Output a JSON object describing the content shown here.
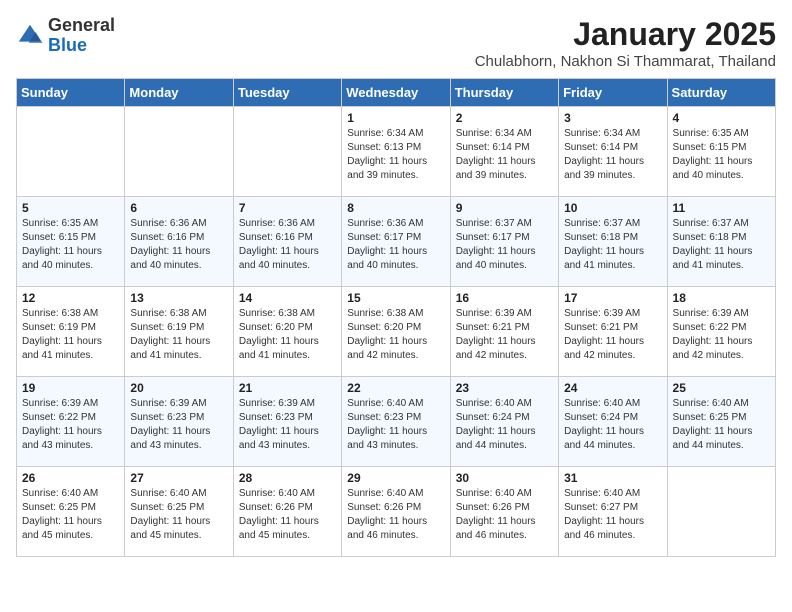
{
  "header": {
    "logo_general": "General",
    "logo_blue": "Blue",
    "title": "January 2025",
    "subtitle": "Chulabhorn, Nakhon Si Thammarat, Thailand"
  },
  "columns": [
    "Sunday",
    "Monday",
    "Tuesday",
    "Wednesday",
    "Thursday",
    "Friday",
    "Saturday"
  ],
  "weeks": [
    [
      {
        "day": "",
        "sunrise": "",
        "sunset": "",
        "daylight": ""
      },
      {
        "day": "",
        "sunrise": "",
        "sunset": "",
        "daylight": ""
      },
      {
        "day": "",
        "sunrise": "",
        "sunset": "",
        "daylight": ""
      },
      {
        "day": "1",
        "sunrise": "6:34 AM",
        "sunset": "6:13 PM",
        "daylight": "11 hours and 39 minutes."
      },
      {
        "day": "2",
        "sunrise": "6:34 AM",
        "sunset": "6:14 PM",
        "daylight": "11 hours and 39 minutes."
      },
      {
        "day": "3",
        "sunrise": "6:34 AM",
        "sunset": "6:14 PM",
        "daylight": "11 hours and 39 minutes."
      },
      {
        "day": "4",
        "sunrise": "6:35 AM",
        "sunset": "6:15 PM",
        "daylight": "11 hours and 40 minutes."
      }
    ],
    [
      {
        "day": "5",
        "sunrise": "6:35 AM",
        "sunset": "6:15 PM",
        "daylight": "11 hours and 40 minutes."
      },
      {
        "day": "6",
        "sunrise": "6:36 AM",
        "sunset": "6:16 PM",
        "daylight": "11 hours and 40 minutes."
      },
      {
        "day": "7",
        "sunrise": "6:36 AM",
        "sunset": "6:16 PM",
        "daylight": "11 hours and 40 minutes."
      },
      {
        "day": "8",
        "sunrise": "6:36 AM",
        "sunset": "6:17 PM",
        "daylight": "11 hours and 40 minutes."
      },
      {
        "day": "9",
        "sunrise": "6:37 AM",
        "sunset": "6:17 PM",
        "daylight": "11 hours and 40 minutes."
      },
      {
        "day": "10",
        "sunrise": "6:37 AM",
        "sunset": "6:18 PM",
        "daylight": "11 hours and 41 minutes."
      },
      {
        "day": "11",
        "sunrise": "6:37 AM",
        "sunset": "6:18 PM",
        "daylight": "11 hours and 41 minutes."
      }
    ],
    [
      {
        "day": "12",
        "sunrise": "6:38 AM",
        "sunset": "6:19 PM",
        "daylight": "11 hours and 41 minutes."
      },
      {
        "day": "13",
        "sunrise": "6:38 AM",
        "sunset": "6:19 PM",
        "daylight": "11 hours and 41 minutes."
      },
      {
        "day": "14",
        "sunrise": "6:38 AM",
        "sunset": "6:20 PM",
        "daylight": "11 hours and 41 minutes."
      },
      {
        "day": "15",
        "sunrise": "6:38 AM",
        "sunset": "6:20 PM",
        "daylight": "11 hours and 42 minutes."
      },
      {
        "day": "16",
        "sunrise": "6:39 AM",
        "sunset": "6:21 PM",
        "daylight": "11 hours and 42 minutes."
      },
      {
        "day": "17",
        "sunrise": "6:39 AM",
        "sunset": "6:21 PM",
        "daylight": "11 hours and 42 minutes."
      },
      {
        "day": "18",
        "sunrise": "6:39 AM",
        "sunset": "6:22 PM",
        "daylight": "11 hours and 42 minutes."
      }
    ],
    [
      {
        "day": "19",
        "sunrise": "6:39 AM",
        "sunset": "6:22 PM",
        "daylight": "11 hours and 43 minutes."
      },
      {
        "day": "20",
        "sunrise": "6:39 AM",
        "sunset": "6:23 PM",
        "daylight": "11 hours and 43 minutes."
      },
      {
        "day": "21",
        "sunrise": "6:39 AM",
        "sunset": "6:23 PM",
        "daylight": "11 hours and 43 minutes."
      },
      {
        "day": "22",
        "sunrise": "6:40 AM",
        "sunset": "6:23 PM",
        "daylight": "11 hours and 43 minutes."
      },
      {
        "day": "23",
        "sunrise": "6:40 AM",
        "sunset": "6:24 PM",
        "daylight": "11 hours and 44 minutes."
      },
      {
        "day": "24",
        "sunrise": "6:40 AM",
        "sunset": "6:24 PM",
        "daylight": "11 hours and 44 minutes."
      },
      {
        "day": "25",
        "sunrise": "6:40 AM",
        "sunset": "6:25 PM",
        "daylight": "11 hours and 44 minutes."
      }
    ],
    [
      {
        "day": "26",
        "sunrise": "6:40 AM",
        "sunset": "6:25 PM",
        "daylight": "11 hours and 45 minutes."
      },
      {
        "day": "27",
        "sunrise": "6:40 AM",
        "sunset": "6:25 PM",
        "daylight": "11 hours and 45 minutes."
      },
      {
        "day": "28",
        "sunrise": "6:40 AM",
        "sunset": "6:26 PM",
        "daylight": "11 hours and 45 minutes."
      },
      {
        "day": "29",
        "sunrise": "6:40 AM",
        "sunset": "6:26 PM",
        "daylight": "11 hours and 46 minutes."
      },
      {
        "day": "30",
        "sunrise": "6:40 AM",
        "sunset": "6:26 PM",
        "daylight": "11 hours and 46 minutes."
      },
      {
        "day": "31",
        "sunrise": "6:40 AM",
        "sunset": "6:27 PM",
        "daylight": "11 hours and 46 minutes."
      },
      {
        "day": "",
        "sunrise": "",
        "sunset": "",
        "daylight": ""
      }
    ]
  ],
  "labels": {
    "sunrise_prefix": "Sunrise: ",
    "sunset_prefix": "Sunset: ",
    "daylight_prefix": "Daylight: "
  }
}
